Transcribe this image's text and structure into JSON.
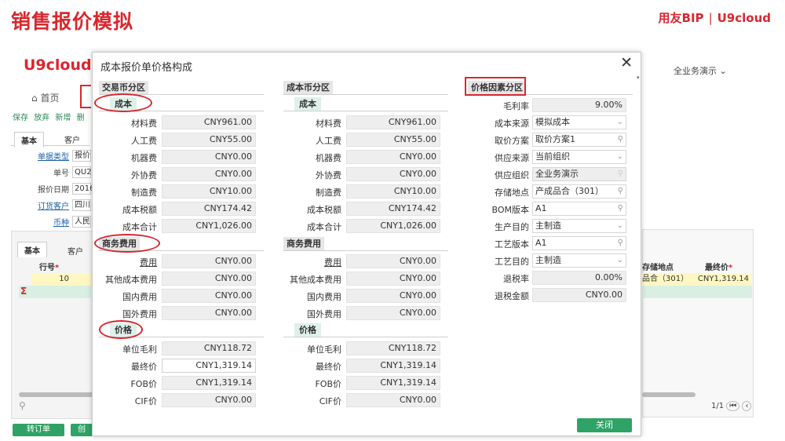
{
  "slide": {
    "title": "销售报价模拟",
    "brand_left": "用友BIP",
    "brand_sep": "|",
    "brand_right": "U9cloud"
  },
  "background": {
    "logo": "U9cloud",
    "org": "全业务演示",
    "home": "首页",
    "toolbar": [
      "保存",
      "放弃",
      "新增",
      "删"
    ],
    "tabs_top": [
      "基本",
      "客户"
    ],
    "fields": [
      {
        "label": "单据类型",
        "value": "报价",
        "link": true
      },
      {
        "label": "单号",
        "value": "QU20",
        "link": false
      },
      {
        "label": "报价日期",
        "value": "2016",
        "link": false
      },
      {
        "label": "订货客户",
        "value": "四川",
        "link": true
      },
      {
        "label": "币种",
        "value": "人民",
        "link": true
      }
    ],
    "tabs_grid": [
      "基本",
      "客户"
    ],
    "grid_headers": [
      "行号",
      "存储地点",
      "最终价"
    ],
    "grid_row": {
      "row_no": "10",
      "location": "品合（301）",
      "final_price": "CNY1,319.14"
    },
    "sigma": "Σ",
    "pager": "1/1",
    "buttons": [
      "转订单",
      "创"
    ]
  },
  "dialog": {
    "title": "成本报价单价格构成",
    "close_label": "关闭",
    "left": {
      "section": "交易币分区",
      "cost_title": "成本",
      "cost_rows": [
        {
          "label": "材料费",
          "value": "CNY961.00"
        },
        {
          "label": "人工费",
          "value": "CNY55.00"
        },
        {
          "label": "机器费",
          "value": "CNY0.00"
        },
        {
          "label": "外协费",
          "value": "CNY0.00"
        },
        {
          "label": "制造费",
          "value": "CNY10.00"
        },
        {
          "label": "成本税额",
          "value": "CNY174.42"
        },
        {
          "label": "成本合计",
          "value": "CNY1,026.00"
        }
      ],
      "biz_title": "商务费用",
      "biz_rows": [
        {
          "label": "费用",
          "value": "CNY0.00"
        },
        {
          "label": "其他成本费用",
          "value": "CNY0.00"
        },
        {
          "label": "国内费用",
          "value": "CNY0.00"
        },
        {
          "label": "国外费用",
          "value": "CNY0.00"
        }
      ],
      "price_title": "价格",
      "price_rows": [
        {
          "label": "单位毛利",
          "value": "CNY118.72"
        },
        {
          "label": "最终价",
          "value": "CNY1,319.14"
        },
        {
          "label": "FOB价",
          "value": "CNY1,319.14"
        },
        {
          "label": "CIF价",
          "value": "CNY0.00"
        }
      ]
    },
    "middle": {
      "section": "成本币分区",
      "cost_title": "成本",
      "cost_rows": [
        {
          "label": "材料费",
          "value": "CNY961.00"
        },
        {
          "label": "人工费",
          "value": "CNY55.00"
        },
        {
          "label": "机器费",
          "value": "CNY0.00"
        },
        {
          "label": "外协费",
          "value": "CNY0.00"
        },
        {
          "label": "制造费",
          "value": "CNY10.00"
        },
        {
          "label": "成本税额",
          "value": "CNY174.42"
        },
        {
          "label": "成本合计",
          "value": "CNY1,026.00"
        }
      ],
      "biz_title": "商务费用",
      "biz_rows": [
        {
          "label": "费用",
          "value": "CNY0.00"
        },
        {
          "label": "其他成本费用",
          "value": "CNY0.00"
        },
        {
          "label": "国内费用",
          "value": "CNY0.00"
        },
        {
          "label": "国外费用",
          "value": "CNY0.00"
        }
      ],
      "price_title": "价格",
      "price_rows": [
        {
          "label": "单位毛利",
          "value": "CNY118.72"
        },
        {
          "label": "最终价",
          "value": "CNY1,319.14"
        },
        {
          "label": "FOB价",
          "value": "CNY1,319.14"
        },
        {
          "label": "CIF价",
          "value": "CNY0.00"
        }
      ]
    },
    "right": {
      "section": "价格因素分区",
      "rows": [
        {
          "label": "毛利率",
          "value": "9.00%",
          "kind": "ro",
          "icon": ""
        },
        {
          "label": "成本来源",
          "value": "模拟成本",
          "kind": "select",
          "icon": "chevron-down-icon"
        },
        {
          "label": "取价方案",
          "value": "取价方案1",
          "kind": "ref",
          "icon": "search-icon"
        },
        {
          "label": "供应来源",
          "value": "当前组织",
          "kind": "select",
          "icon": "chevron-down-icon"
        },
        {
          "label": "供应组织",
          "value": "全业务演示",
          "kind": "ro-left",
          "icon": "search-icon"
        },
        {
          "label": "存储地点",
          "value": "产成品合（301）",
          "kind": "ref",
          "icon": "search-icon"
        },
        {
          "label": "BOM版本",
          "value": "A1",
          "kind": "ref",
          "icon": "search-icon"
        },
        {
          "label": "生产目的",
          "value": "主制造",
          "kind": "select",
          "icon": "chevron-down-icon"
        },
        {
          "label": "工艺版本",
          "value": "A1",
          "kind": "ref",
          "icon": "search-icon"
        },
        {
          "label": "工艺目的",
          "value": "主制造",
          "kind": "select",
          "icon": "chevron-down-icon"
        },
        {
          "label": "退税率",
          "value": "0.00%",
          "kind": "ro",
          "icon": ""
        },
        {
          "label": "退税金额",
          "value": "CNY0.00",
          "kind": "ro",
          "icon": ""
        }
      ]
    }
  },
  "colors": {
    "accent_red": "#d7282f",
    "button_green": "#2ea365",
    "section_gray": "#e6e6e6",
    "sub_green": "#dff0ea"
  }
}
